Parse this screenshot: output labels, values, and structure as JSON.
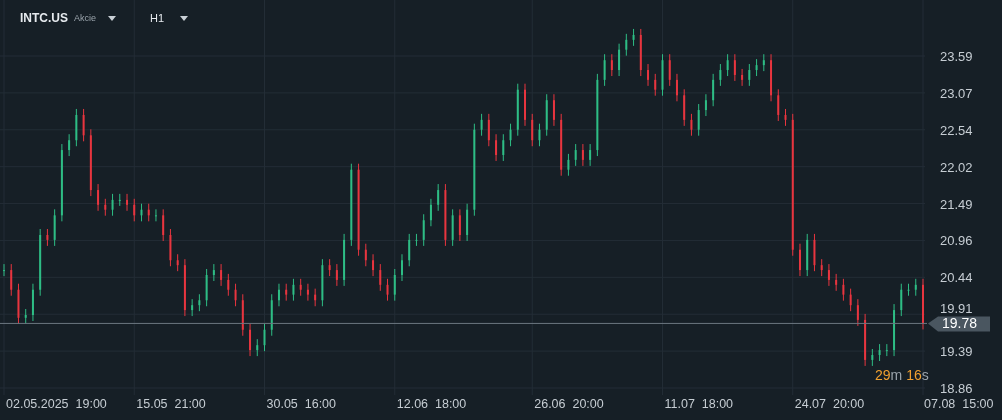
{
  "header": {
    "symbol": "INTC.US",
    "market": "Akcie",
    "timeframe": "H1"
  },
  "price_chart": {
    "kind": "candlestick",
    "price_labels": [
      "23.59",
      "23.07",
      "22.54",
      "22.02",
      "21.49",
      "20.96",
      "20.44",
      "19.91",
      "19.39",
      "18.86"
    ],
    "time_labels": [
      "02.05.2025  19:00",
      "15.05  21:00",
      "30.05  16:00",
      "12.06  18:00",
      "26.06  20:00",
      "11.07  18:00",
      "24.07  20:00",
      "07.08  15:00"
    ],
    "last_price": "19.78"
  },
  "countdown": {
    "minutes": "29",
    "minutes_unit": "m",
    "seconds": "16",
    "seconds_unit": "s"
  }
}
